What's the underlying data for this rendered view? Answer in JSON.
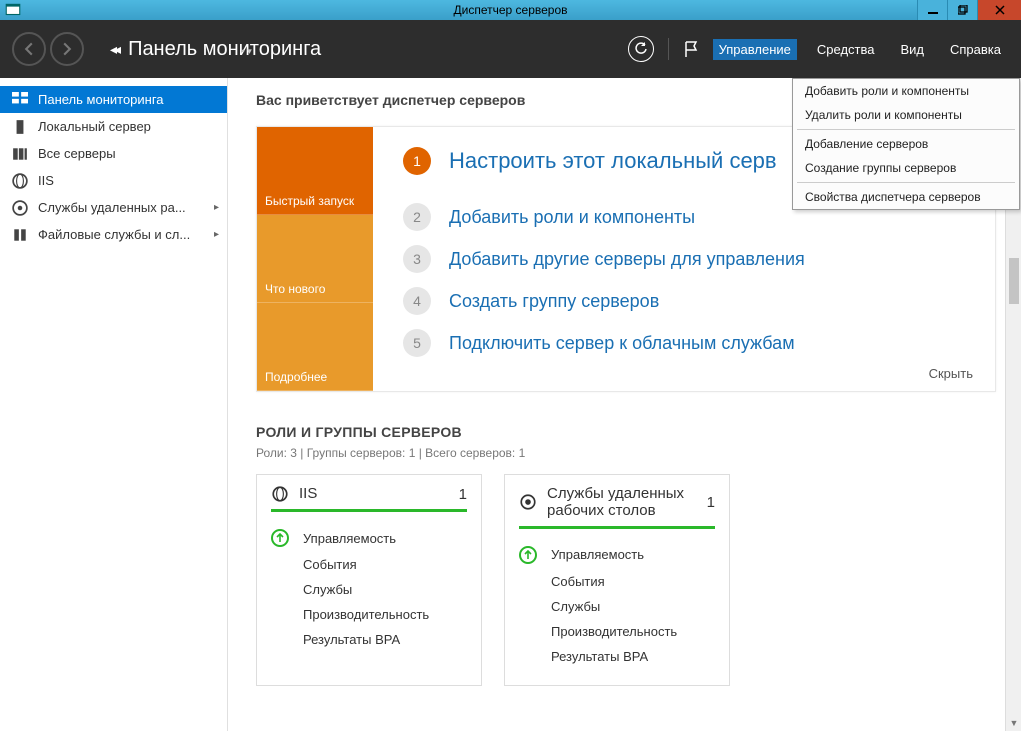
{
  "window": {
    "title": "Диспетчер серверов"
  },
  "header": {
    "breadcrumb": "Панель мониторинга",
    "menu": {
      "manage": "Управление",
      "tools": "Средства",
      "view": "Вид",
      "help": "Справка"
    }
  },
  "dropdown": {
    "add_roles": "Добавить роли и компоненты",
    "remove_roles": "Удалить роли и компоненты",
    "add_servers": "Добавление серверов",
    "create_group": "Создание группы серверов",
    "properties": "Свойства диспетчера серверов"
  },
  "sidebar": {
    "items": [
      {
        "label": "Панель мониторинга"
      },
      {
        "label": "Локальный сервер"
      },
      {
        "label": "Все серверы"
      },
      {
        "label": "IIS"
      },
      {
        "label": "Службы удаленных ра..."
      },
      {
        "label": "Файловые службы и сл..."
      }
    ]
  },
  "welcome": {
    "greeting": "Вас приветствует диспетчер серверов",
    "tabs": {
      "quickstart": "Быстрый запуск",
      "whatsnew": "Что нового",
      "learnmore": "Подробнее"
    },
    "steps": [
      {
        "num": "1",
        "text": "Настроить этот локальный серв"
      },
      {
        "num": "2",
        "text": "Добавить роли и компоненты"
      },
      {
        "num": "3",
        "text": "Добавить другие серверы для управления"
      },
      {
        "num": "4",
        "text": "Создать группу серверов"
      },
      {
        "num": "5",
        "text": "Подключить сервер к облачным службам"
      }
    ],
    "hide": "Скрыть"
  },
  "roles": {
    "title": "РОЛИ И ГРУППЫ СЕРВЕРОВ",
    "subtitle": "Роли: 3 | Группы серверов: 1 | Всего серверов: 1",
    "cards": [
      {
        "title": "IIS",
        "count": "1",
        "rows": {
          "manageability": "Управляемость",
          "events": "События",
          "services": "Службы",
          "performance": "Производительность",
          "bpa": "Результаты BPA"
        }
      },
      {
        "title": "Службы удаленных рабочих столов",
        "count": "1",
        "rows": {
          "manageability": "Управляемость",
          "events": "События",
          "services": "Службы",
          "performance": "Производительность",
          "bpa": "Результаты BPA"
        }
      }
    ]
  }
}
